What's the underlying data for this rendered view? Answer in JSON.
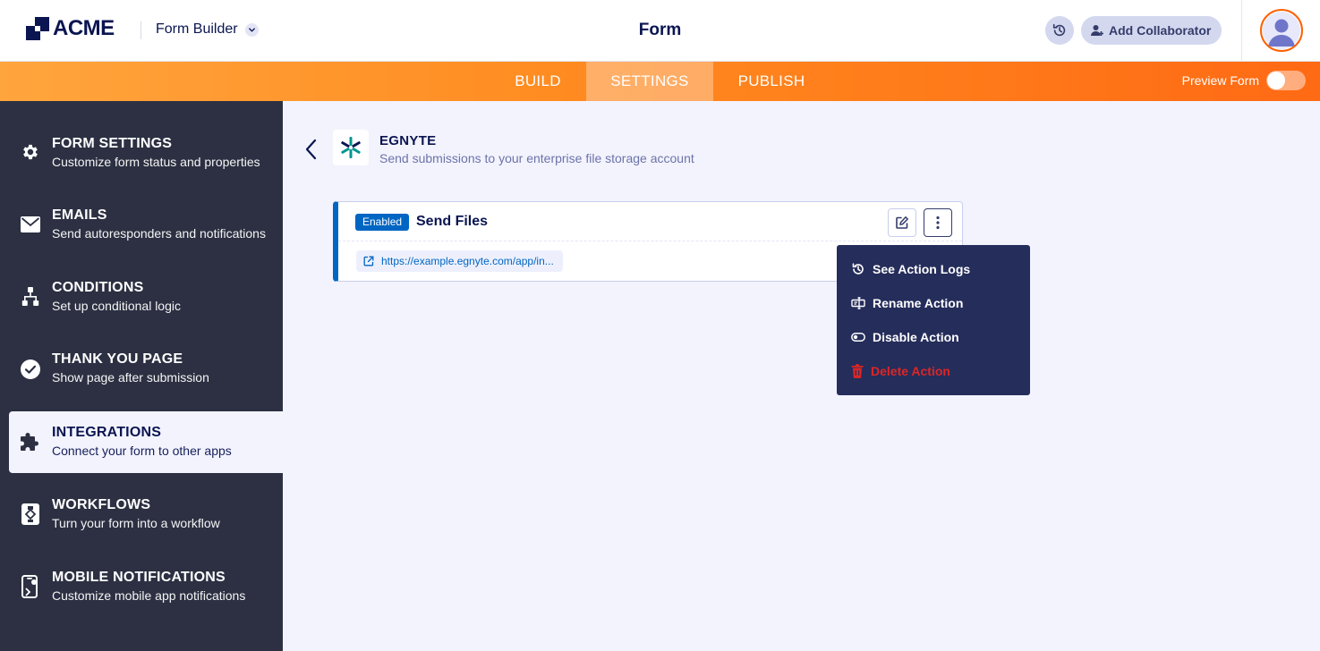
{
  "header": {
    "logo_text": "ACME",
    "product_label": "Form Builder",
    "page_title": "Form",
    "collaborator_label": "Add Collaborator"
  },
  "nav": {
    "tabs": [
      {
        "label": "BUILD",
        "active": false
      },
      {
        "label": "SETTINGS",
        "active": true
      },
      {
        "label": "PUBLISH",
        "active": false
      }
    ],
    "preview_label": "Preview Form"
  },
  "sidebar": {
    "items": [
      {
        "title": "FORM SETTINGS",
        "subtitle": "Customize form status and properties",
        "icon": "gear-icon"
      },
      {
        "title": "EMAILS",
        "subtitle": "Send autoresponders and notifications",
        "icon": "envelope-icon"
      },
      {
        "title": "CONDITIONS",
        "subtitle": "Set up conditional logic",
        "icon": "hierarchy-icon"
      },
      {
        "title": "THANK YOU PAGE",
        "subtitle": "Show page after submission",
        "icon": "check-circle-icon"
      },
      {
        "title": "INTEGRATIONS",
        "subtitle": "Connect your form to other apps",
        "icon": "puzzle-icon",
        "active": true
      },
      {
        "title": "WORKFLOWS",
        "subtitle": "Turn your form into a workflow",
        "icon": "workflow-icon"
      },
      {
        "title": "MOBILE NOTIFICATIONS",
        "subtitle": "Customize mobile app notifications",
        "icon": "mobile-icon"
      }
    ]
  },
  "integration": {
    "name": "EGNYTE",
    "description": "Send submissions to your enterprise file storage account"
  },
  "action_card": {
    "status": "Enabled",
    "title": "Send Files",
    "url": "https://example.egnyte.com/app/in..."
  },
  "menu": {
    "items": [
      {
        "label": "See Action Logs",
        "icon": "history-icon"
      },
      {
        "label": "Rename Action",
        "icon": "rename-icon"
      },
      {
        "label": "Disable Action",
        "icon": "toggle-icon"
      },
      {
        "label": "Delete Action",
        "icon": "trash-icon",
        "danger": true
      }
    ]
  },
  "colors": {
    "brand_navy": "#0a1551",
    "accent_orange": "#ff6100",
    "enabled_blue": "#0066c3",
    "sidebar_bg": "#2c3042",
    "menu_bg": "#252d5b",
    "danger": "#dc2626"
  }
}
